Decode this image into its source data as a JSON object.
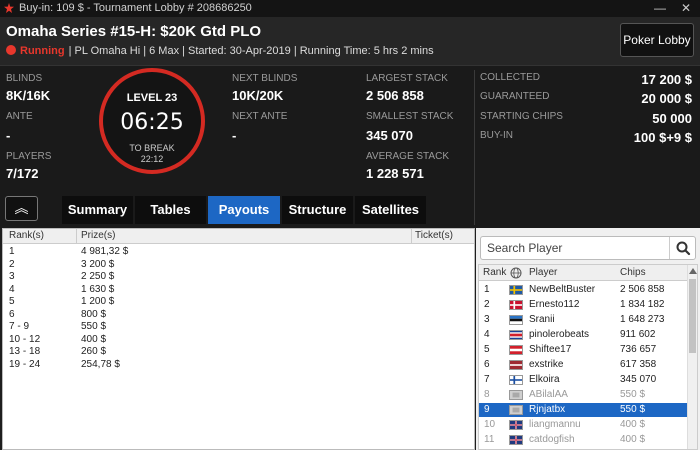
{
  "window": {
    "title": "Buy-in: 109 $ - Tournament Lobby # 208686250",
    "minimize_glyph": "—",
    "close_glyph": "✕"
  },
  "header": {
    "tournament_name": "Omaha Series #15-H: $20K Gtd PLO",
    "status": "Running",
    "details": "| PL Omaha Hi | 6 Max | Started: 30-Apr-2019 | Running Time: 5 hrs  2 mins",
    "lobby_button": "Poker Lobby"
  },
  "info": {
    "blinds_label": "BLINDS",
    "blinds_value": "8K/16K",
    "ante_label": "ANTE",
    "ante_value": "-",
    "players_label": "PLAYERS",
    "players_value": "7/172",
    "level": "LEVEL 23",
    "timer": "06:25",
    "to_break_label": "TO BREAK",
    "to_break_value": "22:12",
    "next_blinds_label": "NEXT BLINDS",
    "next_blinds_value": "10K/20K",
    "next_ante_label": "NEXT ANTE",
    "next_ante_value": "-",
    "largest_stack_label": "LARGEST STACK",
    "largest_stack_value": "2 506 858",
    "smallest_stack_label": "SMALLEST STACK",
    "smallest_stack_value": "345 070",
    "average_stack_label": "AVERAGE STACK",
    "average_stack_value": "1 228 571",
    "collected_label": "COLLECTED",
    "collected_value": "17 200 $",
    "guaranteed_label": "GUARANTEED",
    "guaranteed_value": "20 000 $",
    "starting_chips_label": "STARTING CHIPS",
    "starting_chips_value": "50 000",
    "buyin_label": "BUY-IN",
    "buyin_value": "100 $+9 $"
  },
  "collapse_glyph": "︽",
  "tabs": [
    {
      "label": "Summary"
    },
    {
      "label": "Tables"
    },
    {
      "label": "Payouts",
      "active": true
    },
    {
      "label": "Structure"
    },
    {
      "label": "Satellites"
    }
  ],
  "payouts": {
    "headers": {
      "rank": "Rank(s)",
      "prize": "Prize(s)",
      "ticket": "Ticket(s)"
    },
    "rows": [
      {
        "rank": "1",
        "prize": "4 981,32 $"
      },
      {
        "rank": "2",
        "prize": "3 200 $"
      },
      {
        "rank": "3",
        "prize": "2 250 $"
      },
      {
        "rank": "4",
        "prize": "1 630 $"
      },
      {
        "rank": "5",
        "prize": "1 200 $"
      },
      {
        "rank": "6",
        "prize": "800 $"
      },
      {
        "rank": "7 - 9",
        "prize": "550 $"
      },
      {
        "rank": "10 - 12",
        "prize": "400 $"
      },
      {
        "rank": "13 - 18",
        "prize": "260 $"
      },
      {
        "rank": "19 - 24",
        "prize": "254,78 $"
      }
    ]
  },
  "players": {
    "search_placeholder": "Search Player",
    "headers": {
      "rank": "Rank",
      "player": "Player",
      "chips": "Chips"
    },
    "rows": [
      {
        "rank": "1",
        "player": "NewBeltBuster",
        "chips": "2 506 858",
        "flag": "sweden"
      },
      {
        "rank": "2",
        "player": "Ernesto112",
        "chips": "1 834 182",
        "flag": "denmark"
      },
      {
        "rank": "3",
        "player": "Sranii",
        "chips": "1 648 273",
        "flag": "estonia"
      },
      {
        "rank": "4",
        "player": "pinolerobeats",
        "chips": "911 602",
        "flag": "costa-rica"
      },
      {
        "rank": "5",
        "player": "Shiftee17",
        "chips": "736 657",
        "flag": "austria"
      },
      {
        "rank": "6",
        "player": "exstrike",
        "chips": "617 358",
        "flag": "latvia"
      },
      {
        "rank": "7",
        "player": "Elkoira",
        "chips": "345 070",
        "flag": "finland"
      },
      {
        "rank": "8",
        "player": "ABilalAA",
        "chips": "550 $",
        "flag": "generic"
      },
      {
        "rank": "9",
        "player": "Rjnjatbx",
        "chips": "550 $",
        "flag": "generic",
        "selected": true
      },
      {
        "rank": "10",
        "player": "liangmannu",
        "chips": "400 $",
        "flag": "uk"
      },
      {
        "rank": "11",
        "player": "catdogfish",
        "chips": "400 $",
        "flag": "uk"
      }
    ]
  },
  "colors": {
    "accent_blue": "#1d67c4",
    "running_red": "#e8372c",
    "clock_ring": "#d42a22"
  }
}
